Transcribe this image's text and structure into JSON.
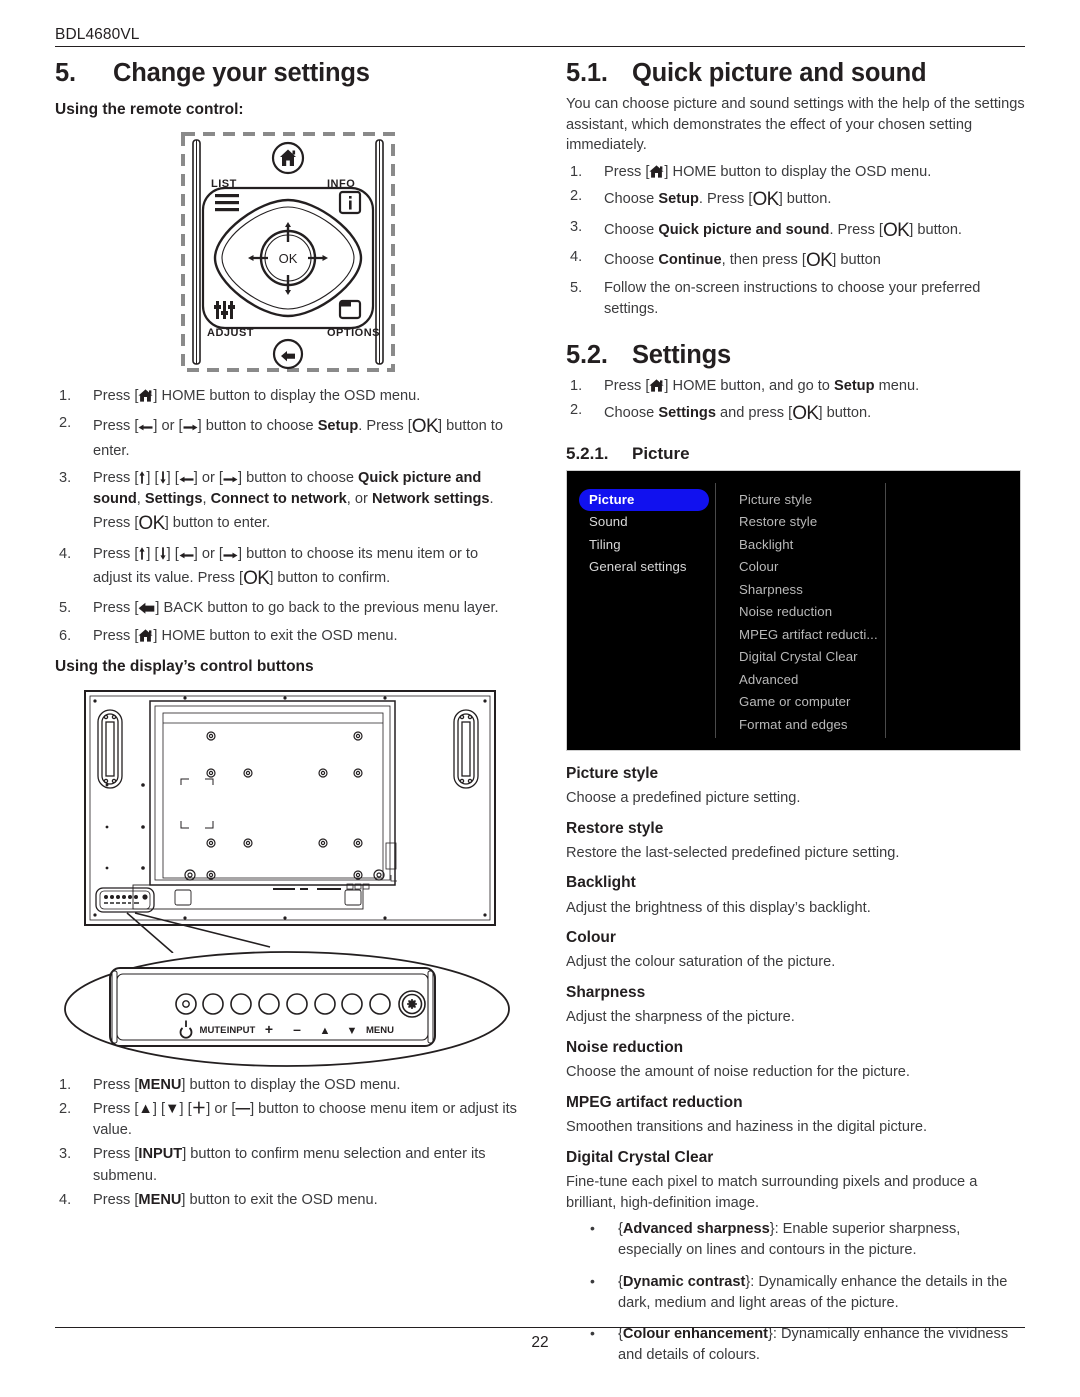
{
  "header": {
    "model": "BDL4680VL"
  },
  "footer": {
    "page_number": "22"
  },
  "left": {
    "section_number": "5.",
    "section_title": "Change your settings",
    "remote_heading": "Using the remote control:",
    "remote": {
      "label_list": "LIST",
      "label_info": "INFO",
      "label_adjust": "ADJUST",
      "label_options": "OPTIONS",
      "label_ok": "OK"
    },
    "remote_steps": [
      {
        "prefix": "Press [",
        "icon": "home-icon",
        "mid": "] HOME button to display the OSD menu.",
        "text": "Press [home] HOME button to display the OSD menu."
      },
      {
        "text": "Press [←] or [→] button to choose Setup. Press [OK] button to enter."
      },
      {
        "text": "Press [↑] [↓] [←] or [→] button to choose Quick picture and sound, Settings, Connect to network, or Network settings. Press [OK] button to enter."
      },
      {
        "text": "Press [↑] [↓] [←] or [→] button to choose its menu item or to adjust its value. Press [OK] button to confirm."
      },
      {
        "text": "Press [back] BACK button to go back to the previous menu layer."
      },
      {
        "text": "Press [home] HOME button to exit the OSD menu."
      }
    ],
    "remote_steps_parts": {
      "s1_a": "Press [",
      "s1_b": "] HOME button to display the OSD menu.",
      "s2_a": "Press [",
      "s2_b": "] or [",
      "s2_c": "] button to choose ",
      "s2_bold": "Setup",
      "s2_d": ". Press [",
      "s2_e": "] button to enter.",
      "s3_a": "Press [",
      "s3_b": "] [",
      "s3_c": "] [",
      "s3_d": "] or [",
      "s3_e": "] button to choose ",
      "s3_bold1": "Quick picture and sound",
      "s3_sep1": ", ",
      "s3_bold2": "Settings",
      "s3_sep2": ", ",
      "s3_bold3": "Connect to network",
      "s3_sep3": ", or ",
      "s3_bold4": "Network settings",
      "s3_f": ". Press [",
      "s3_g": "] button to enter.",
      "s4_a": "Press [",
      "s4_b": "] [",
      "s4_c": "] [",
      "s4_d": "] or [",
      "s4_e": "] button to choose its menu item or to adjust its value. Press [",
      "s4_f": "] button to confirm.",
      "s5_a": "Press [",
      "s5_b": "] BACK button to go back to the previous menu layer.",
      "s6_a": "Press [",
      "s6_b": "] HOME button to exit the OSD menu."
    },
    "display_heading": "Using the display’s control buttons",
    "control_panel_labels": [
      "MUTE",
      "INPUT",
      "+",
      "–",
      "▲",
      "▼",
      "MENU"
    ],
    "display_steps_parts": {
      "d1_a": "Press [",
      "d1_key": "MENU",
      "d1_b": "] button to display the OSD menu.",
      "d2_a": "Press [",
      "d2_k1": "▲",
      "d2_b": "] [",
      "d2_k2": "▼",
      "d2_c": "] [",
      "d2_k3": "＋",
      "d2_d": "] or [",
      "d2_k4": "—",
      "d2_e": "] button to choose menu item or adjust its value.",
      "d3_a": "Press [",
      "d3_key": "INPUT",
      "d3_b": "] button to confirm menu selection and enter its submenu.",
      "d4_a": "Press [",
      "d4_key": "MENU",
      "d4_b": "] button to exit the OSD menu."
    }
  },
  "right": {
    "s51_number": "5.1.",
    "s51_title": "Quick picture and sound",
    "s51_intro": "You can choose picture and sound settings with the help of the settings assistant, which demonstrates the effect of your chosen setting immediately.",
    "s51_steps_parts": {
      "q1_a": "Press [",
      "q1_b": "] HOME button to display the OSD menu.",
      "q2_a": "Choose ",
      "q2_bold": "Setup",
      "q2_b": ". Press [",
      "q2_c": "] button.",
      "q3_a": "Choose ",
      "q3_bold": "Quick picture and sound",
      "q3_b": ". Press [",
      "q3_c": "] button.",
      "q4_a": "Choose ",
      "q4_bold": "Continue",
      "q4_b": ", then press [",
      "q4_c": "] button",
      "q5": "Follow the on-screen instructions to choose your preferred settings."
    },
    "s52_number": "5.2.",
    "s52_title": "Settings",
    "s52_steps_parts": {
      "t1_a": "Press [",
      "t1_b": "] HOME button, and go to ",
      "t1_bold": "Setup",
      "t1_c": " menu.",
      "t2_a": "Choose ",
      "t2_bold": "Settings",
      "t2_b": " and press [",
      "t2_c": "] button."
    },
    "s521_number": "5.2.1.",
    "s521_title": "Picture",
    "osd": {
      "accent_color": "#1111ef",
      "background_color": "#000000",
      "menu": [
        {
          "label": "Picture",
          "selected": true
        },
        {
          "label": "Sound",
          "selected": false
        },
        {
          "label": "Tiling",
          "selected": false
        },
        {
          "label": "General settings",
          "selected": false
        }
      ],
      "submenu": [
        "Picture style",
        "Restore style",
        "Backlight",
        "Colour",
        "Sharpness",
        "Noise reduction",
        "MPEG artifact reducti...",
        "Digital Crystal Clear",
        "Advanced",
        "Game or computer",
        "Format and edges"
      ]
    },
    "definitions": [
      {
        "term": "Picture style",
        "desc": "Choose a predefined picture setting."
      },
      {
        "term": "Restore style",
        "desc": "Restore the last-selected predefined picture setting."
      },
      {
        "term": "Backlight",
        "desc": "Adjust the brightness of this display’s backlight."
      },
      {
        "term": "Colour",
        "desc": "Adjust the colour saturation of the picture."
      },
      {
        "term": "Sharpness",
        "desc": "Adjust the sharpness of the picture."
      },
      {
        "term": "Noise reduction",
        "desc": "Choose the amount of noise reduction for the picture."
      },
      {
        "term": "MPEG artifact reduction",
        "desc": "Smoothen transitions and haziness in the digital picture."
      },
      {
        "term": "Digital Crystal Clear",
        "desc": "Fine-tune each pixel to match surrounding pixels and produce a brilliant, high-definition image."
      }
    ],
    "dcc_bullets": [
      {
        "open": "{",
        "term": "Advanced sharpness",
        "close": "}",
        "desc": ": Enable superior sharpness, especially on lines and contours in the picture."
      },
      {
        "open": "{",
        "term": "Dynamic contrast",
        "close": "}",
        "desc": ": Dynamically enhance the details in the dark, medium and light areas of the picture."
      },
      {
        "open": "{",
        "term": "Colour enhancement",
        "close": "}",
        "desc": ": Dynamically enhance the vividness and details of colours."
      }
    ]
  }
}
